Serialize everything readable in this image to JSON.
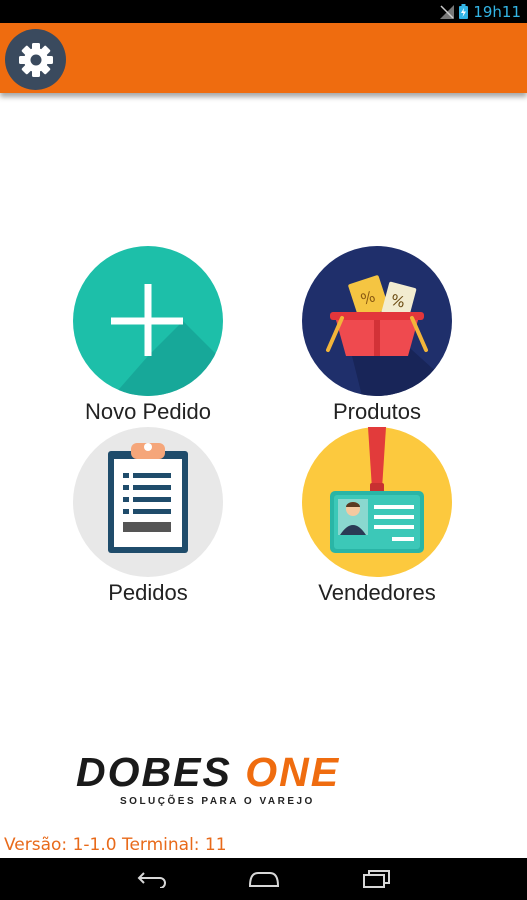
{
  "status_bar": {
    "time": "19h11"
  },
  "header": {
    "settings_icon": "gear-icon"
  },
  "menu": {
    "items": [
      {
        "label": "Novo Pedido",
        "icon": "plus-icon"
      },
      {
        "label": "Produtos",
        "icon": "basket-icon"
      },
      {
        "label": "Pedidos",
        "icon": "clipboard-icon"
      },
      {
        "label": "Vendedores",
        "icon": "badge-icon"
      }
    ]
  },
  "logo": {
    "name_part1": "DOBES",
    "name_part2": "ONE",
    "tagline": "SOLUÇÕES PARA O VAREJO"
  },
  "footer": {
    "version_text": "Versão: 1-1.0 Terminal: 11"
  },
  "colors": {
    "accent": "#ef6c0f",
    "teal": "#1dbfa9",
    "navy": "#1f2f6b",
    "yellow": "#fcc93e",
    "gray": "#e8e8e8"
  }
}
